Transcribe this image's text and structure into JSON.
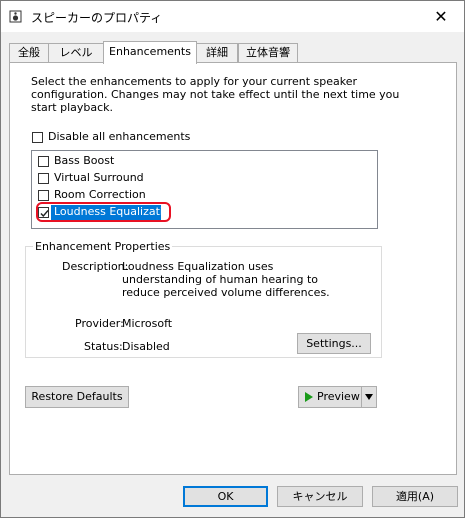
{
  "window": {
    "title": "スピーカーのプロパティ",
    "close_glyph": "✕"
  },
  "tabs": [
    {
      "label": "全般"
    },
    {
      "label": "レベル"
    },
    {
      "label": "Enhancements",
      "active": true
    },
    {
      "label": "詳細"
    },
    {
      "label": "立体音響"
    }
  ],
  "enhancements": {
    "description": "Select the enhancements to apply for your current speaker configuration. Changes may not take effect until the next time you start playback.",
    "disable_all": {
      "label": "Disable all enhancements",
      "checked": false
    },
    "items": [
      {
        "label": "Bass Boost",
        "checked": false
      },
      {
        "label": "Virtual Surround",
        "checked": false
      },
      {
        "label": "Room Correction",
        "checked": false
      },
      {
        "label": "Loudness Equalization",
        "checked": true,
        "selected": true
      }
    ]
  },
  "properties": {
    "group_title": "Enhancement Properties",
    "description_label": "Description:",
    "description_value": "Loudness Equalization uses understanding of human hearing to reduce perceived volume differences.",
    "provider_label": "Provider:",
    "provider_value": "Microsoft",
    "status_label": "Status:",
    "status_value": "Disabled",
    "settings_button": "Settings..."
  },
  "actions": {
    "restore_defaults": "Restore Defaults",
    "preview": "Preview"
  },
  "footer": {
    "ok": "OK",
    "cancel": "キャンセル",
    "apply": "適用(A)"
  },
  "colors": {
    "selection": "#0078d7",
    "highlight_ring": "#e81123",
    "play_icon": "#1a9a1a"
  }
}
